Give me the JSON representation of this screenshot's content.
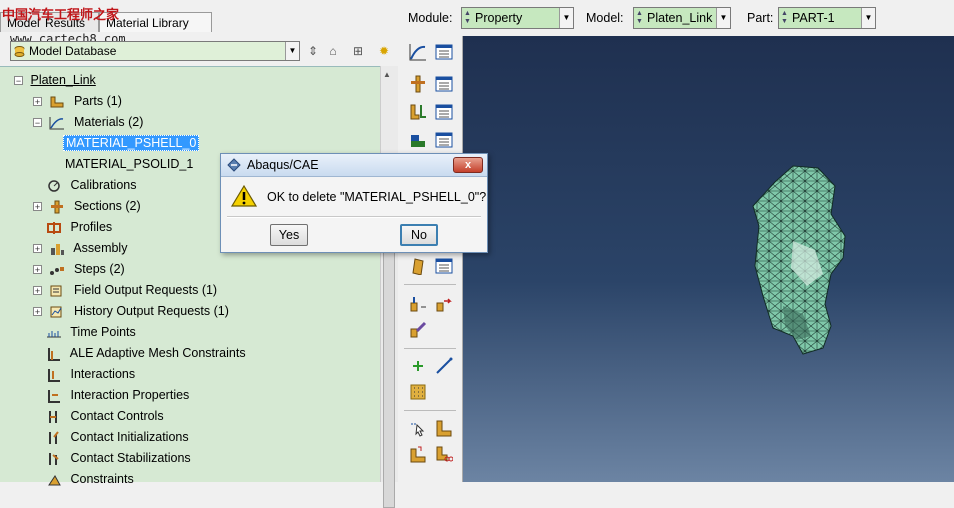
{
  "watermark": {
    "title": "中国汽车工程师之家",
    "url": "www.cartech8.com"
  },
  "tabs": [
    {
      "label": "Model"
    },
    {
      "label": "Results"
    },
    {
      "label": "Material Library"
    }
  ],
  "database_select": {
    "value": "Model Database"
  },
  "module_bar": {
    "module_label": "Module:",
    "module_value": "Property",
    "model_label": "Model:",
    "model_value": "Platen_Link",
    "part_label": "Part:",
    "part_value": "PART-1"
  },
  "tree": {
    "root": "Platen_Link",
    "items": [
      {
        "label": "Parts (1)"
      },
      {
        "label": "Materials (2)"
      },
      {
        "label": "MATERIAL_PSHELL_0"
      },
      {
        "label": "MATERIAL_PSOLID_1"
      },
      {
        "label": "Calibrations"
      },
      {
        "label": "Sections (2)"
      },
      {
        "label": "Profiles"
      },
      {
        "label": "Assembly"
      },
      {
        "label": "Steps (2)"
      },
      {
        "label": "Field Output Requests (1)"
      },
      {
        "label": "History Output Requests (1)"
      },
      {
        "label": "Time Points"
      },
      {
        "label": "ALE Adaptive Mesh Constraints"
      },
      {
        "label": "Interactions"
      },
      {
        "label": "Interaction Properties"
      },
      {
        "label": "Contact Controls"
      },
      {
        "label": "Contact Initializations"
      },
      {
        "label": "Contact Stabilizations"
      },
      {
        "label": "Constraints"
      }
    ]
  },
  "dialog": {
    "title": "Abaqus/CAE",
    "message": "OK to delete \"MATERIAL_PSHELL_0\"?",
    "yes_label": "Yes",
    "no_label": "No",
    "close_label": "x"
  },
  "colors": {
    "tree_bg": "#d6e9d3",
    "selection": "#3399ff",
    "viewport_top": "#1f3050",
    "viewport_bottom": "#6c84a3",
    "mesh_fill": "#7fc8a9"
  },
  "icons": [
    "database-icon",
    "material-icon",
    "section-icon",
    "assembly-icon",
    "warning-icon",
    "close-icon",
    "abaqus-logo-icon"
  ]
}
